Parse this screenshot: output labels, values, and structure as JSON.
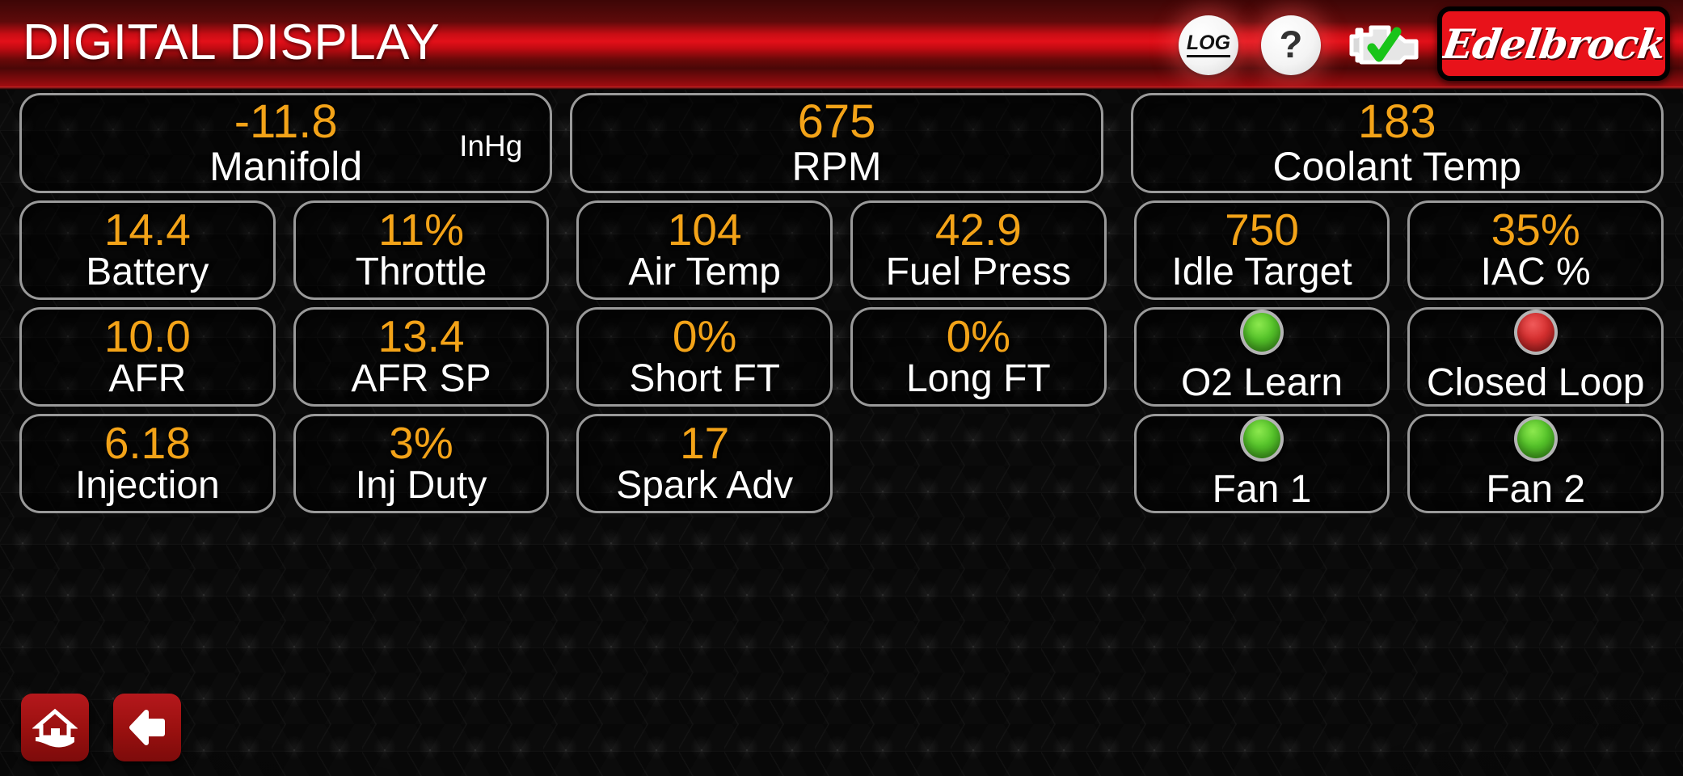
{
  "header": {
    "title": "DIGITAL DISPLAY",
    "log_label": "LOG",
    "help_label": "?",
    "engine_status_icon": "engine-check-ok-icon",
    "brand_name": "Edelbrock"
  },
  "colors": {
    "value_orange": "#f3a318",
    "label_white": "#ffffff",
    "led_green": "#55c42a",
    "led_red": "#d62f2f",
    "brand_red": "#e8121a",
    "tile_border": "#9a9a9a"
  },
  "rows": [
    {
      "tiles": [
        {
          "value": "-11.8",
          "label": "Manifold",
          "unit": "InHg",
          "kind": "value",
          "span": 2
        },
        {
          "value": "675",
          "label": "RPM",
          "kind": "value",
          "span": 2
        },
        {
          "value": "183",
          "label": "Coolant Temp",
          "kind": "value",
          "span": 2
        }
      ]
    },
    {
      "tiles": [
        {
          "value": "14.4",
          "label": "Battery",
          "kind": "value"
        },
        {
          "value": "11%",
          "label": "Throttle",
          "kind": "value"
        },
        {
          "value": "104",
          "label": "Air Temp",
          "kind": "value"
        },
        {
          "value": "42.9",
          "label": "Fuel Press",
          "kind": "value"
        },
        {
          "value": "750",
          "label": "Idle Target",
          "kind": "value"
        },
        {
          "value": "35%",
          "label": "IAC %",
          "kind": "value"
        }
      ]
    },
    {
      "tiles": [
        {
          "value": "10.0",
          "label": "AFR",
          "kind": "value"
        },
        {
          "value": "13.4",
          "label": "AFR SP",
          "kind": "value"
        },
        {
          "value": "0%",
          "label": "Short FT",
          "kind": "value"
        },
        {
          "value": "0%",
          "label": "Long FT",
          "kind": "value"
        },
        {
          "label": "O2 Learn",
          "kind": "led",
          "led": "green"
        },
        {
          "label": "Closed Loop",
          "kind": "led",
          "led": "red"
        }
      ]
    },
    {
      "tiles": [
        {
          "value": "6.18",
          "label": "Injection",
          "kind": "value"
        },
        {
          "value": "3%",
          "label": "Inj Duty",
          "kind": "value"
        },
        {
          "value": "17",
          "label": "Spark Adv",
          "kind": "value"
        },
        {
          "kind": "empty"
        },
        {
          "label": "Fan 1",
          "kind": "led",
          "led": "green"
        },
        {
          "label": "Fan 2",
          "kind": "led",
          "led": "green"
        }
      ]
    }
  ],
  "nav": {
    "home_icon": "home-icon",
    "back_icon": "back-arrow-icon"
  }
}
